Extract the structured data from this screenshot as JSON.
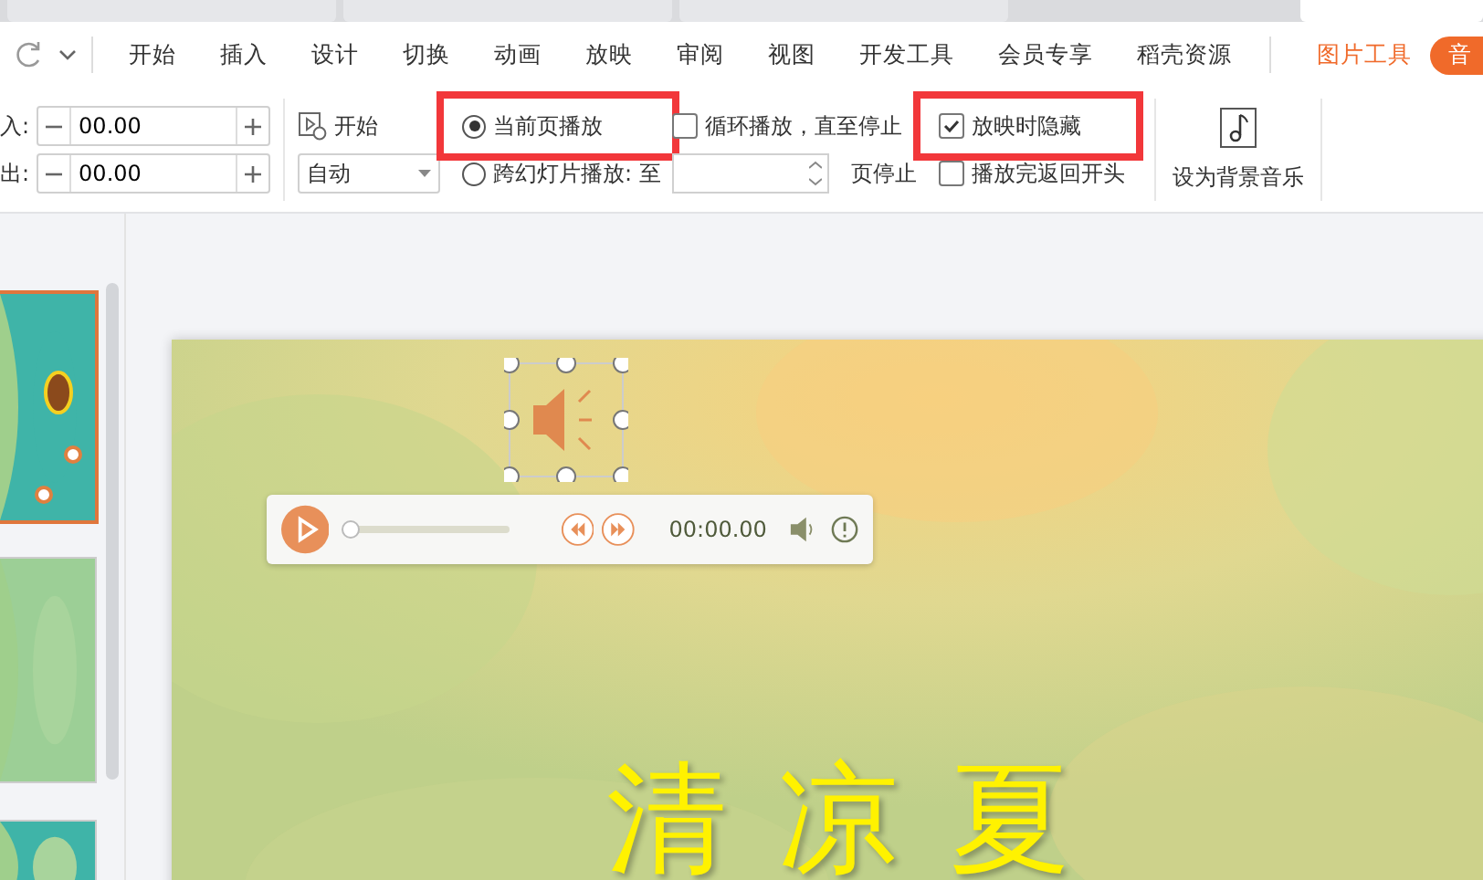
{
  "menu_tabs": [
    {
      "label": "开始"
    },
    {
      "label": "插入"
    },
    {
      "label": "设计"
    },
    {
      "label": "切换"
    },
    {
      "label": "动画"
    },
    {
      "label": "放映"
    },
    {
      "label": "审阅"
    },
    {
      "label": "视图"
    },
    {
      "label": "开发工具"
    },
    {
      "label": "会员专享"
    },
    {
      "label": "稻壳资源"
    }
  ],
  "context_tab": {
    "label": "图片工具"
  },
  "action_button": {
    "label": "音"
  },
  "ribbon": {
    "fades": [
      {
        "label": "入:",
        "value": "00.00"
      },
      {
        "label": "出:",
        "value": "00.00"
      }
    ],
    "start": {
      "label": "开始",
      "dropdown": "自动"
    },
    "play_mode": [
      {
        "label": "当前页播放",
        "selected": true,
        "highlighted": true
      },
      {
        "label": "跨幻灯片播放: 至",
        "selected": false,
        "highlighted": false
      }
    ],
    "page_stop": "页停止",
    "loop": {
      "label": "循环播放，直至停止",
      "checked": false
    },
    "options": [
      {
        "label": "放映时隐藏",
        "checked": true,
        "highlighted": true
      },
      {
        "label": "播放完返回开头",
        "checked": false,
        "highlighted": false
      }
    ],
    "bgm_button": {
      "label": "设为背景音乐"
    }
  },
  "player": {
    "level": 0,
    "time": "00:00.00"
  },
  "slide": {
    "title": "清凉夏"
  }
}
